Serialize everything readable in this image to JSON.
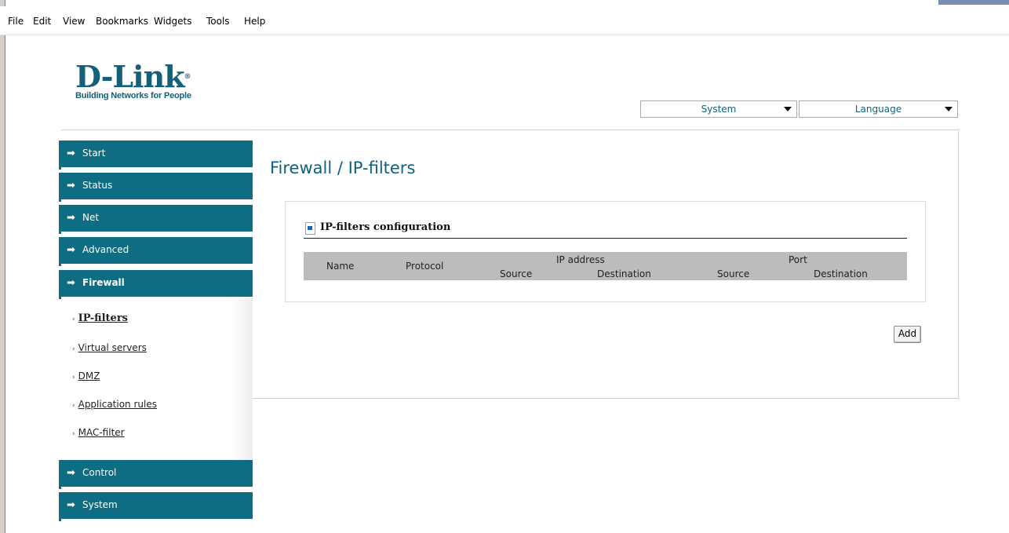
{
  "menu": {
    "items": [
      "File",
      "Edit",
      "View",
      "Bookmarks",
      "Widgets",
      "Tools",
      "Help"
    ]
  },
  "logo": {
    "brand": "D-Link",
    "registered": "®",
    "tagline": "Building Networks for People"
  },
  "top_selects": {
    "system": "System",
    "language": "Language"
  },
  "nav": {
    "items": [
      {
        "label": "Start"
      },
      {
        "label": "Status"
      },
      {
        "label": "Net"
      },
      {
        "label": "Advanced"
      },
      {
        "label": "Firewall"
      },
      {
        "label": "Control"
      },
      {
        "label": "System"
      }
    ],
    "submenu": [
      {
        "label": "IP-filters"
      },
      {
        "label": "Virtual servers"
      },
      {
        "label": "DMZ"
      },
      {
        "label": "Application rules"
      },
      {
        "label": "MAC-filter"
      }
    ],
    "bullet": "›",
    "arrow": "➡"
  },
  "main": {
    "title": "Firewall / IP-filters",
    "section_title": "IP-filters configuration",
    "table": {
      "name": "Name",
      "protocol": "Protocol",
      "ip_address": "IP address",
      "port": "Port",
      "ip_source": "Source",
      "ip_destination": "Destination",
      "port_source": "Source",
      "port_destination": "Destination"
    },
    "add_button": "Add"
  },
  "colors": {
    "accent": "#0e6d82",
    "title": "#13607a",
    "table_header": "#bcbcbc"
  }
}
